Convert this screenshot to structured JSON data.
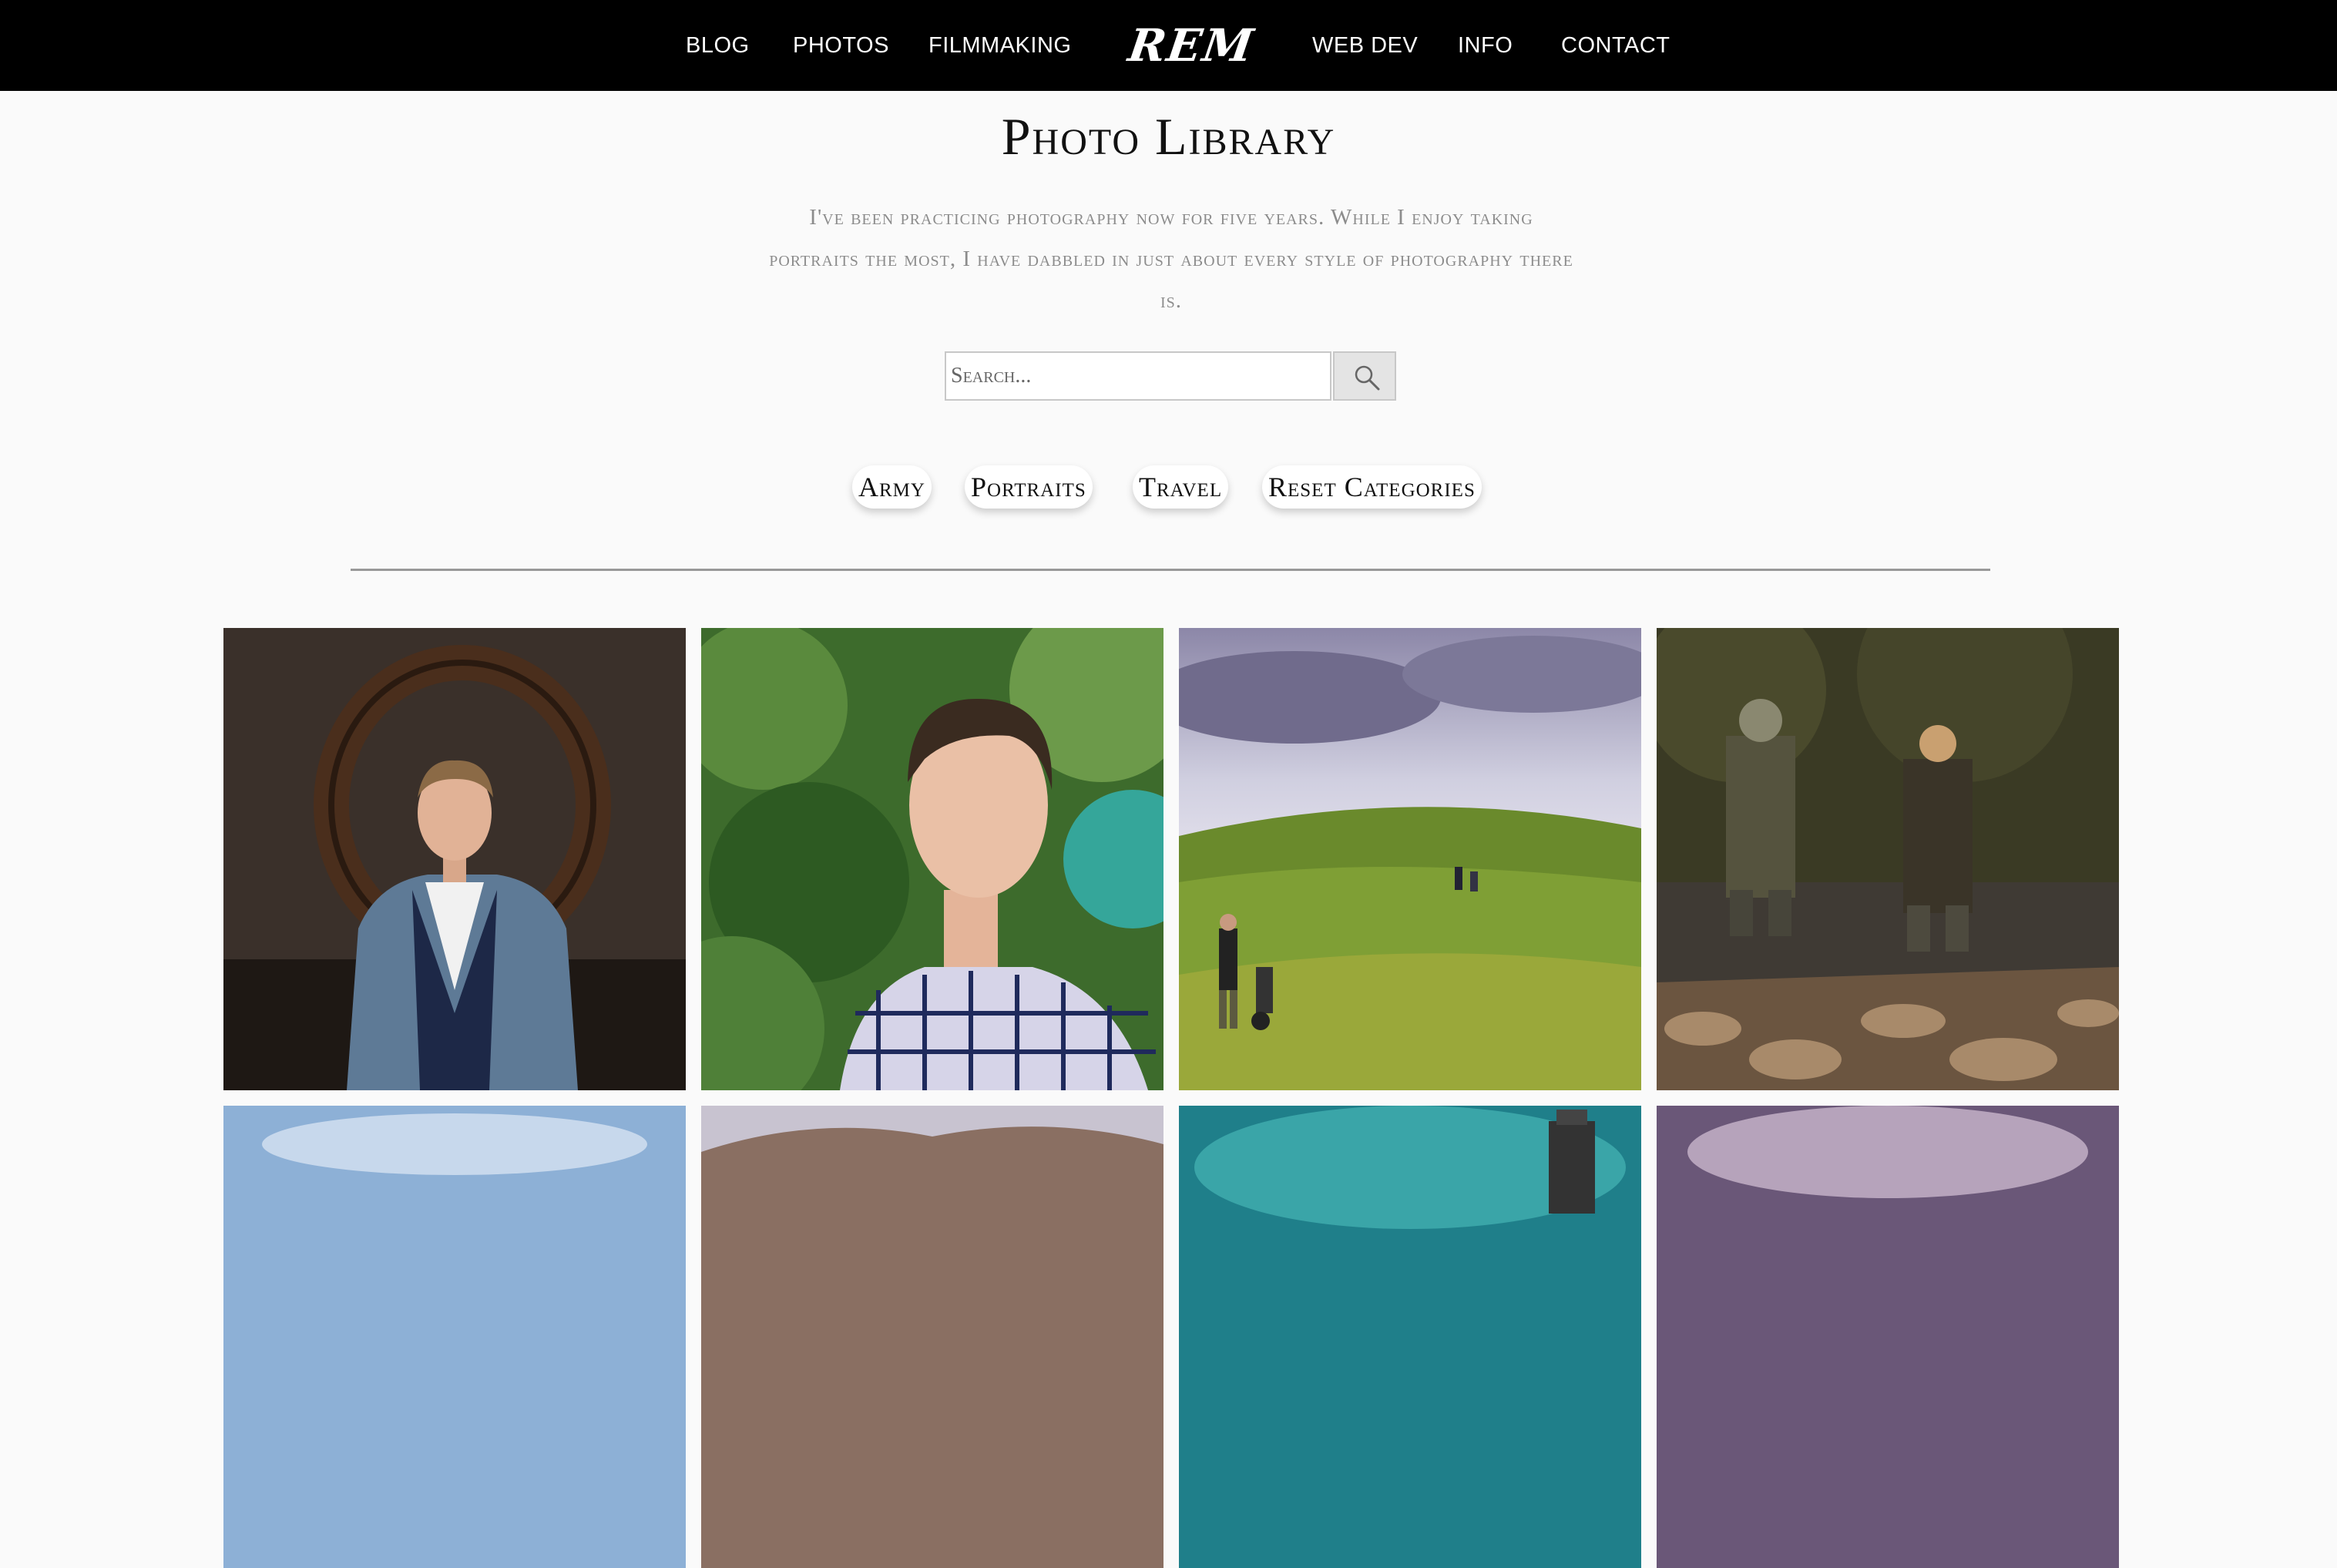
{
  "nav": {
    "links_left": [
      "BLOG",
      "PHOTOS",
      "FILMMAKING"
    ],
    "logo": "REM",
    "links_right": [
      "WEB DEV",
      "INFO",
      "CONTACT"
    ]
  },
  "page": {
    "title": "Photo Library",
    "intro": "I've been practicing photography now for five years. While I enjoy taking portraits the most, I have dabbled in just about every style of photography there is."
  },
  "search": {
    "placeholder": "Search...",
    "button_icon": "search-icon"
  },
  "categories": [
    "Army",
    "Portraits",
    "Travel",
    "Reset Categories"
  ],
  "gallery": {
    "photos": [
      {
        "subject": "portrait-man-blue-blazer"
      },
      {
        "subject": "portrait-man-plaid-shirt"
      },
      {
        "subject": "golfers-green-field"
      },
      {
        "subject": "fishermen-river"
      },
      {
        "subject": "sky-landscape"
      },
      {
        "subject": "mountain-landscape"
      },
      {
        "subject": "teal-sky-tower"
      },
      {
        "subject": "purple-sky"
      }
    ]
  }
}
